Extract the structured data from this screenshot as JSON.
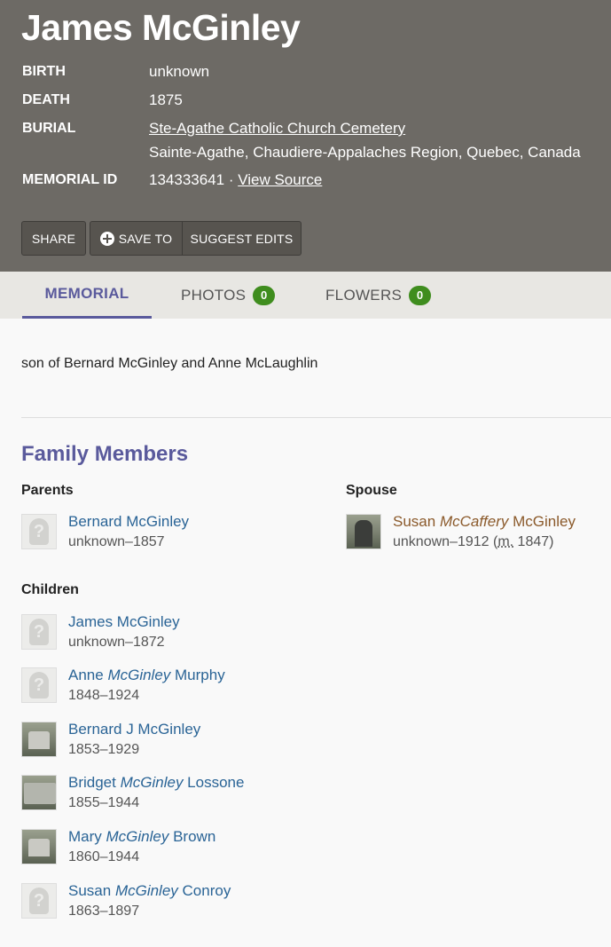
{
  "memorial": {
    "name": "James McGinley",
    "birth_label": "BIRTH",
    "birth_value": "unknown",
    "death_label": "DEATH",
    "death_value": "1875",
    "burial_label": "BURIAL",
    "burial_cemetery": "Ste-Agathe Catholic Church Cemetery",
    "burial_location": "Sainte-Agathe, Chaudiere-Appalaches Region, Quebec, Canada",
    "memorial_id_label": "MEMORIAL ID",
    "memorial_id_value": "134333641 · ",
    "view_source": "View Source"
  },
  "buttons": {
    "share": "SHARE",
    "save_to": "SAVE TO",
    "suggest_edits": "SUGGEST EDITS"
  },
  "tabs": {
    "memorial": "MEMORIAL",
    "photos": "PHOTOS",
    "photos_count": "0",
    "flowers": "FLOWERS",
    "flowers_count": "0"
  },
  "bio": "son of Bernard McGinley and Anne McLaughlin",
  "family": {
    "title": "Family Members",
    "parents_label": "Parents",
    "spouse_label": "Spouse",
    "children_label": "Children",
    "parents": [
      {
        "first": "Bernard McGinley",
        "maiden": "",
        "last": "",
        "dates": "unknown–1857",
        "photo": "unknown-icon"
      }
    ],
    "spouse": [
      {
        "first": "Susan ",
        "maiden": "McCaffery",
        "last": " McGinley",
        "dates": "unknown–1912 (",
        "marriage_abbr": "m.",
        "marriage_year": " 1847)",
        "photo": "headstone-photo"
      }
    ],
    "children": [
      {
        "first": "James McGinley",
        "maiden": "",
        "last": "",
        "dates": "unknown–1872",
        "photo": "unknown-icon"
      },
      {
        "first": "Anne ",
        "maiden": "McGinley",
        "last": " Murphy",
        "dates": "1848–1924",
        "photo": "unknown-icon"
      },
      {
        "first": "Bernard J McGinley",
        "maiden": "",
        "last": "",
        "dates": "1853–1929",
        "photo": "headstone-photo"
      },
      {
        "first": "Bridget ",
        "maiden": "McGinley",
        "last": " Lossone",
        "dates": "1855–1944",
        "photo": "headstone-photo"
      },
      {
        "first": "Mary ",
        "maiden": "McGinley",
        "last": " Brown",
        "dates": "1860–1944",
        "photo": "headstone-photo"
      },
      {
        "first": "Susan ",
        "maiden": "McGinley",
        "last": " Conroy",
        "dates": "1863–1897",
        "photo": "unknown-icon"
      }
    ]
  },
  "colors": {
    "header_bg": "#6d6a65",
    "accent": "#5a5a9c",
    "link": "#2a6496",
    "badge": "#3f8d1e"
  }
}
